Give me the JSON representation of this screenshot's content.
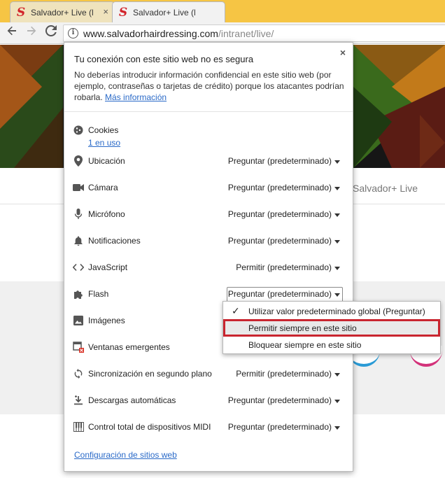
{
  "browser": {
    "tabs": [
      {
        "title": "Salvador+ Live (l",
        "favicon": "S",
        "active": false
      },
      {
        "title": "Salvador+ Live (l",
        "favicon": "S",
        "active": true
      }
    ],
    "tab_close_glyph": "×",
    "url_host": "www.salvadorhairdressing.com",
    "url_path": "/intranet/live/"
  },
  "page": {
    "brand": "Salvador+ Live"
  },
  "popup": {
    "title": "Tu conexión con este sitio web no es segura",
    "description": "No deberías introducir información confidencial en este sitio web (por ejemplo, contraseñas o tarjetas de crédito) porque los atacantes podrían robarla.",
    "more_link": "Más información",
    "close_glyph": "×",
    "cookies": {
      "label": "Cookies",
      "sub": "1 en uso",
      "icon": "cookie-icon"
    },
    "permissions": [
      {
        "label": "Ubicación",
        "value": "Preguntar (predeterminado)",
        "icon": "location-pin-icon"
      },
      {
        "label": "Cámara",
        "value": "Preguntar (predeterminado)",
        "icon": "camera-icon"
      },
      {
        "label": "Micrófono",
        "value": "Preguntar (predeterminado)",
        "icon": "microphone-icon"
      },
      {
        "label": "Notificaciones",
        "value": "Preguntar (predeterminado)",
        "icon": "bell-icon"
      },
      {
        "label": "JavaScript",
        "value": "Permitir (predeterminado)",
        "icon": "code-icon"
      },
      {
        "label": "Flash",
        "value": "Preguntar (predeterminado)",
        "icon": "puzzle-icon"
      },
      {
        "label": "Imágenes",
        "value": "",
        "icon": "image-icon"
      },
      {
        "label": "Ventanas emergentes",
        "value": "",
        "icon": "popup-blocked-icon"
      },
      {
        "label": "Sincronización en segundo plano",
        "value": "Permitir (predeterminado)",
        "icon": "sync-icon"
      },
      {
        "label": "Descargas automáticas",
        "value": "Preguntar (predeterminado)",
        "icon": "download-icon"
      },
      {
        "label": "Control total de dispositivos MIDI",
        "value": "Preguntar (predeterminado)",
        "icon": "midi-piano-icon"
      }
    ],
    "footer_link": "Configuración de sitios web"
  },
  "flash_dropdown": {
    "options": [
      {
        "label": "Utilizar valor predeterminado global (Preguntar)",
        "checked": true
      },
      {
        "label": "Permitir siempre en este sitio",
        "checked": false,
        "highlighted": true
      },
      {
        "label": "Bloquear siempre en este sitio",
        "checked": false
      }
    ],
    "check_glyph": "✓"
  },
  "colors": {
    "tabstrip": "#f6c544",
    "link": "#2a6ac8",
    "highlight_border": "#c9252f",
    "favicon": "#d2232a"
  }
}
